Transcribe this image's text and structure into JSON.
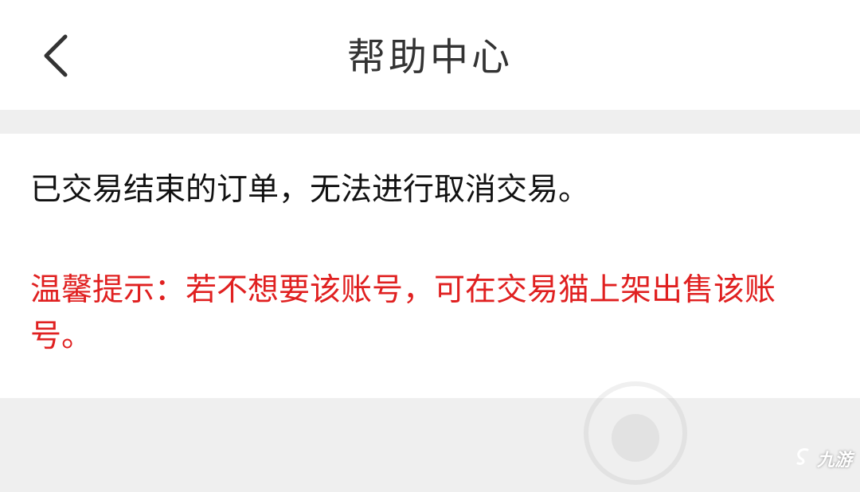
{
  "header": {
    "title": "帮助中心",
    "back_icon": "chevron-left-icon"
  },
  "article": {
    "answer": "已交易结束的订单，无法进行取消交易。",
    "tip": "温馨提示：若不想要该账号，可在交易猫上架出售该账号。"
  },
  "colors": {
    "header_bg": "#ffffff",
    "page_bg": "#efefef",
    "answer_text": "#111111",
    "tip_text": "#e02020"
  },
  "watermark": {
    "brand": "九游"
  }
}
